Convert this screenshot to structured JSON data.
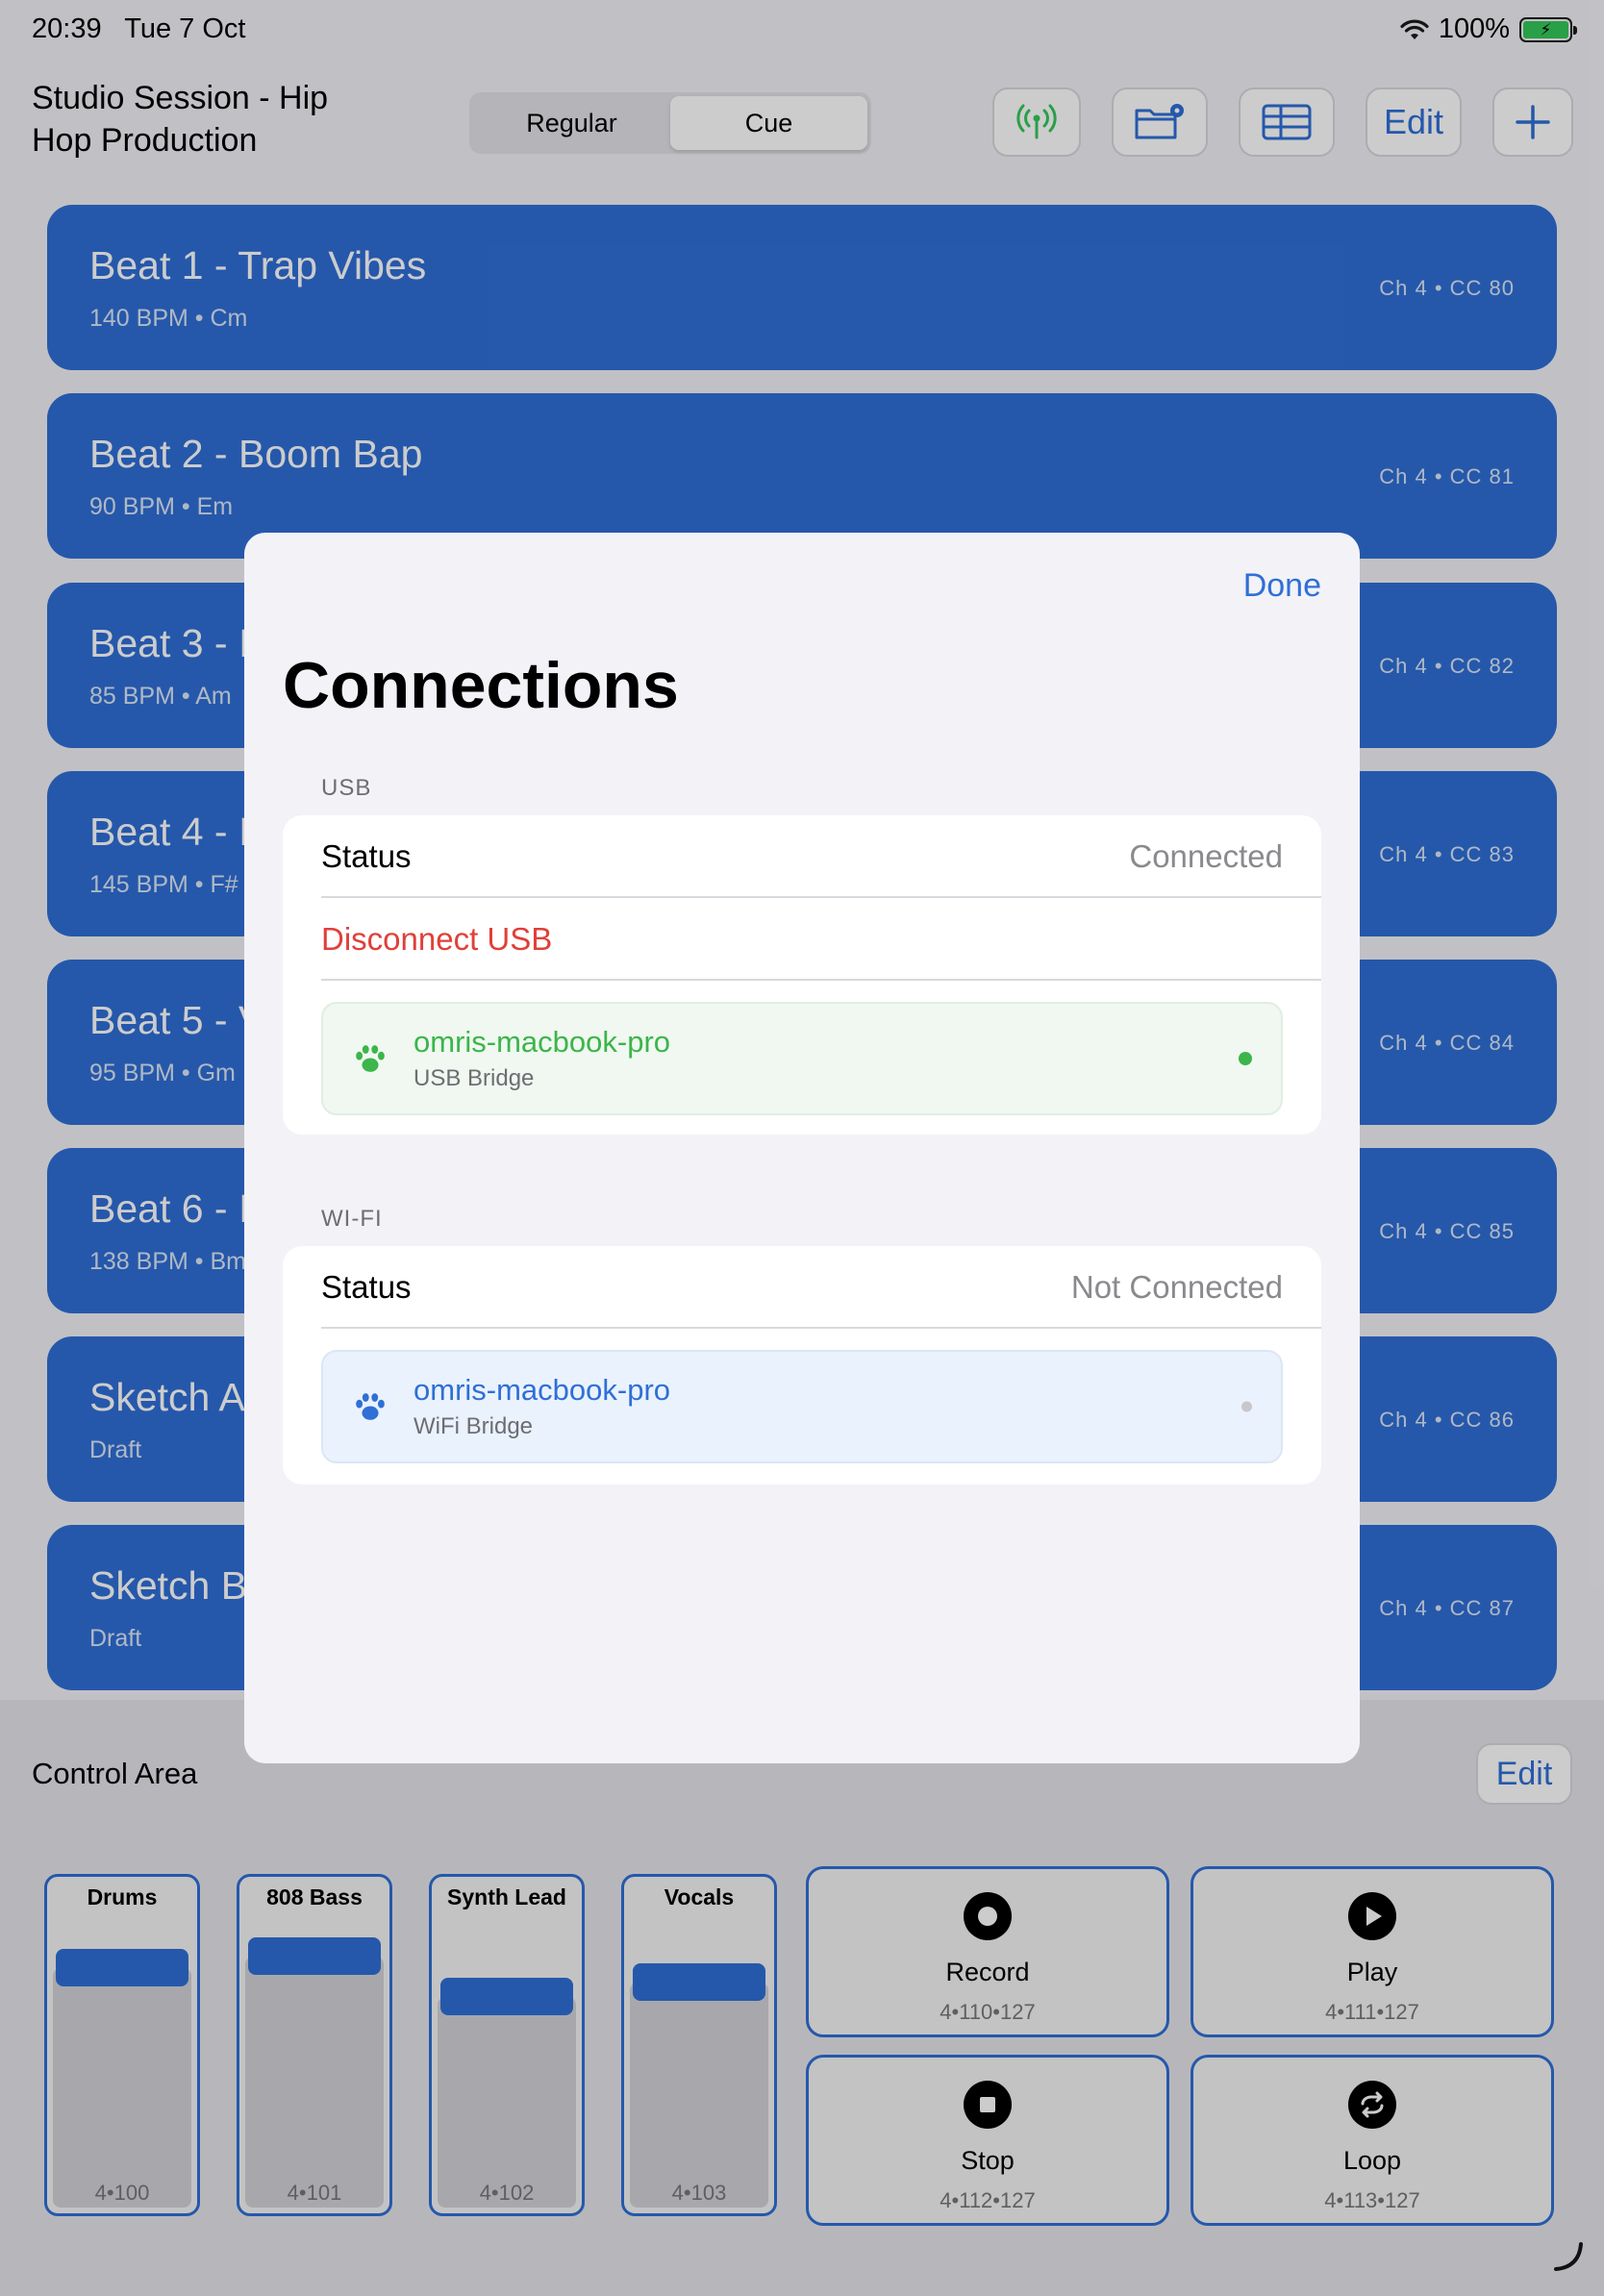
{
  "status_bar": {
    "time": "20:39",
    "date": "Tue 7 Oct",
    "battery": "100%",
    "wifi_icon": "wifi-icon"
  },
  "header": {
    "session_title": "Studio Session - Hip Hop Production",
    "segments": [
      "Regular",
      "Cue"
    ],
    "active_segment": "Cue",
    "edit_label": "Edit",
    "add_label": "+",
    "accent": "#2f6fd6"
  },
  "beats": [
    {
      "title": "Beat 1 - Trap Vibes",
      "sub": "140 BPM • Cm",
      "cc": "Ch 4  •  CC 80"
    },
    {
      "title": "Beat 2 - Boom Bap",
      "sub": "90 BPM • Em",
      "cc": "Ch 4  •  CC 81"
    },
    {
      "title": "Beat 3 - I",
      "sub": "85 BPM • Am",
      "cc": "Ch 4  •  CC 82"
    },
    {
      "title": "Beat 4 - I",
      "sub": "145 BPM • F#",
      "cc": "Ch 4  •  CC 83"
    },
    {
      "title": "Beat 5 - V",
      "sub": "95 BPM • Gm",
      "cc": "Ch 4  •  CC 84"
    },
    {
      "title": "Beat 6 - I",
      "sub": "138 BPM • Bm",
      "cc": "Ch 4  •  CC 85"
    },
    {
      "title": "Sketch A",
      "sub": "Draft",
      "cc": "Ch 4  •  CC 86"
    },
    {
      "title": "Sketch B",
      "sub": "Draft",
      "cc": "Ch 4  •  CC 87"
    }
  ],
  "control_area": {
    "title": "Control Area",
    "edit_label": "Edit",
    "faders": [
      {
        "label": "Drums",
        "cc": "4•100",
        "level": 0.83
      },
      {
        "label": "808 Bass",
        "cc": "4•101",
        "level": 0.87
      },
      {
        "label": "Synth Lead",
        "cc": "4•102",
        "level": 0.73
      },
      {
        "label": "Vocals",
        "cc": "4•103",
        "level": 0.78
      }
    ],
    "pads": [
      {
        "label": "Record",
        "cc": "4•110•127",
        "icon": "record-icon"
      },
      {
        "label": "Play",
        "cc": "4•111•127",
        "icon": "play-icon"
      },
      {
        "label": "Stop",
        "cc": "4•112•127",
        "icon": "stop-icon"
      },
      {
        "label": "Loop",
        "cc": "4•113•127",
        "icon": "loop-icon"
      }
    ]
  },
  "modal": {
    "done_label": "Done",
    "title": "Connections",
    "usb": {
      "header": "USB",
      "status_label": "Status",
      "status_value": "Connected",
      "disconnect_label": "Disconnect USB",
      "device_name": "omris-macbook-pro",
      "device_kind": "USB Bridge",
      "dot_color": "#3cb54a"
    },
    "wifi": {
      "header": "WI-FI",
      "status_label": "Status",
      "status_value": "Not Connected",
      "device_name": "omris-macbook-pro",
      "device_kind": "WiFi Bridge",
      "dot_color": "#c7c7cc"
    }
  }
}
